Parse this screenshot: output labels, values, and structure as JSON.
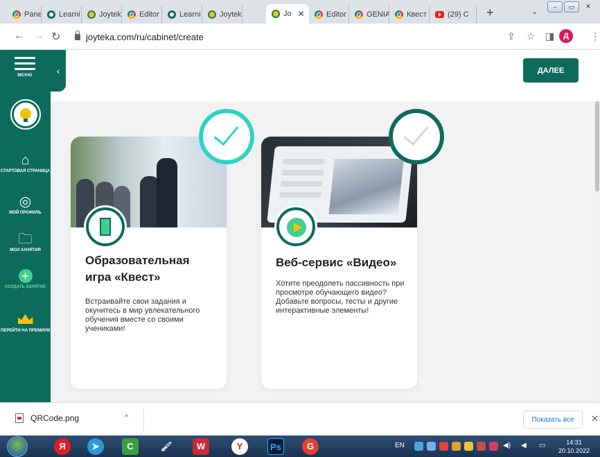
{
  "browser": {
    "tabs": [
      {
        "label": "Panel",
        "icon": "chrome-icon"
      },
      {
        "label": "Learni",
        "icon": "joyteka-icon"
      },
      {
        "label": "Joytek",
        "icon": "joyteka-bulb-icon"
      },
      {
        "label": "Editor",
        "icon": "chrome-icon"
      },
      {
        "label": "Learni",
        "icon": "joyteka-icon"
      },
      {
        "label": "Joytek",
        "icon": "joyteka-bulb-icon"
      },
      {
        "label": "Jo",
        "icon": "joyteka-bulb-icon",
        "active": true
      },
      {
        "label": "Editor",
        "icon": "chrome-icon"
      },
      {
        "label": "GENIA",
        "icon": "chrome-icon"
      },
      {
        "label": "Квест",
        "icon": "chrome-icon"
      },
      {
        "label": "(29) C",
        "icon": "youtube-icon"
      }
    ],
    "new_tab": "+",
    "url": "joyteka.com/ru/cabinet/create",
    "profile_letter": "Д"
  },
  "sidebar": {
    "menu_label": "МЕНЮ",
    "items": [
      {
        "label": "СТАРТОВАЯ СТРАНИЦА",
        "icon": "home-icon"
      },
      {
        "label": "МОЙ ПРОФИЛЬ",
        "icon": "profile-icon"
      },
      {
        "label": "МОИ ЗАНЯТИЯ",
        "icon": "folder-icon"
      },
      {
        "label": "СОЗДАТЬ ЗАНЯТИЕ",
        "icon": "plus-icon"
      },
      {
        "label": "ПЕРЕЙТИ НА ПРЕМИУМ",
        "icon": "crown-icon"
      }
    ]
  },
  "header": {
    "next_label": "ДАЛЕЕ"
  },
  "cards": [
    {
      "title": "Образовательная игра «Квест»",
      "description": "Встраивайте свои задания и окунитесь в мир увлекательного обучения вместе со своими учениками!",
      "selected": true
    },
    {
      "title": "Веб-сервис «Видео»",
      "description": "Хотите преодолеть пассивность при просмотре обучающего видео? Добавьте вопросы, тесты и другие интерактивные элементы!",
      "selected": false
    }
  ],
  "downloads": {
    "file_name": "QRCode.png",
    "show_all_label": "Показать все"
  },
  "taskbar": {
    "lang": "EN",
    "time": "14:31",
    "date": "20.10.2022"
  },
  "colors": {
    "brand": "#0d6b5c",
    "accent": "#2bd4c6",
    "green": "#3fcf8e",
    "yellow": "#f4c20d"
  }
}
